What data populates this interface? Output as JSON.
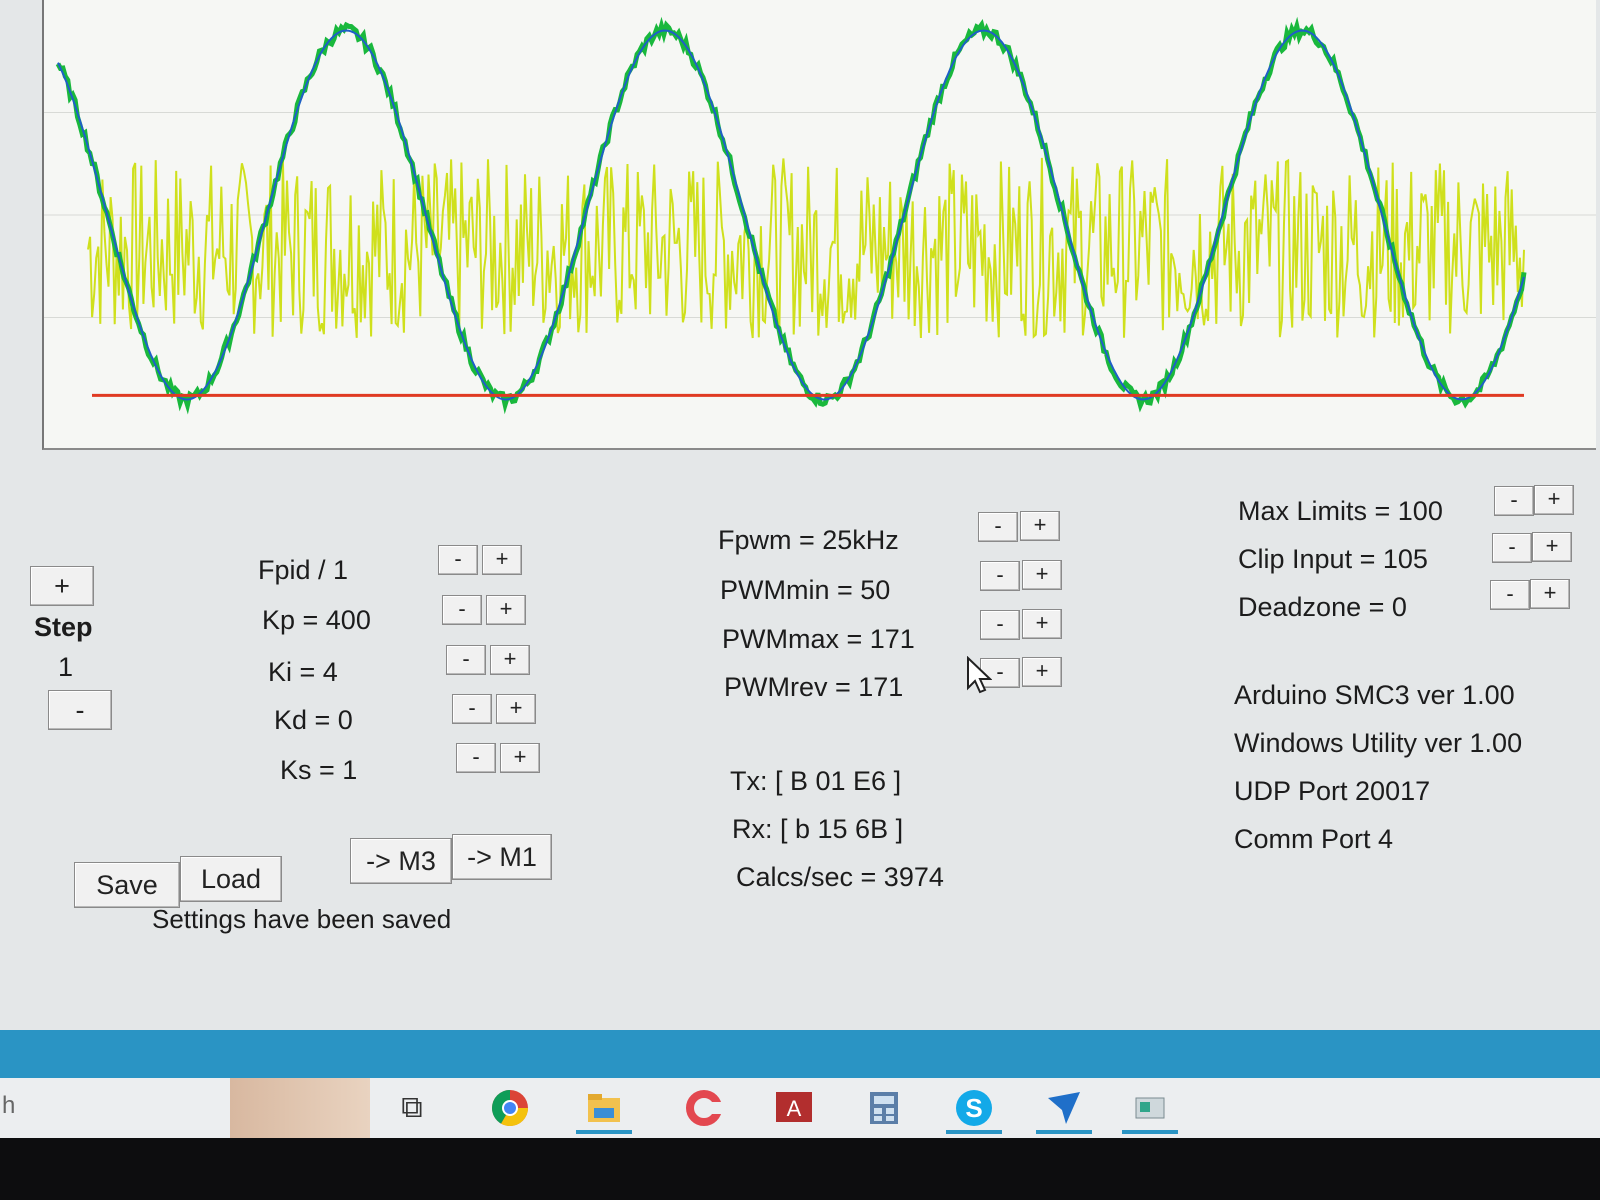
{
  "left_controls": {
    "step_plus": "+",
    "step_label": "Step",
    "step_value": "1",
    "step_minus": "-"
  },
  "pid": {
    "rows": [
      {
        "label": "Fpid / 1",
        "minus": "-",
        "plus": "+"
      },
      {
        "label": "Kp = 400",
        "minus": "-",
        "plus": "+"
      },
      {
        "label": "Ki = 4",
        "minus": "-",
        "plus": "+"
      },
      {
        "label": "Kd = 0",
        "minus": "-",
        "plus": "+"
      },
      {
        "label": "Ks = 1",
        "minus": "-",
        "plus": "+"
      }
    ]
  },
  "pwm": {
    "rows": [
      {
        "label": "Fpwm = 25kHz",
        "minus": "-",
        "plus": "+"
      },
      {
        "label": "PWMmin = 50",
        "minus": "-",
        "plus": "+"
      },
      {
        "label": "PWMmax = 171",
        "minus": "-",
        "plus": "+"
      },
      {
        "label": "PWMrev = 171",
        "minus": "-",
        "plus": "+"
      }
    ]
  },
  "limits": {
    "rows": [
      {
        "label": "Max Limits = 100",
        "minus": "-",
        "plus": "+"
      },
      {
        "label": "Clip Input = 105",
        "minus": "-",
        "plus": "+"
      },
      {
        "label": "Deadzone = 0",
        "minus": "-",
        "plus": "+"
      }
    ]
  },
  "comms": {
    "tx": "Tx: [ B 01 E6 ]",
    "rx": "Rx: [ b 15 6B ]",
    "calcs": "Calcs/sec = 3974"
  },
  "info": {
    "arduino": "Arduino SMC3 ver 1.00",
    "windows": "Windows Utility ver 1.00",
    "udp": "UDP Port 20017",
    "comm": "Comm Port 4"
  },
  "buttons": {
    "save": "Save",
    "load": "Load",
    "m3": "-> M3",
    "m1": "-> M1"
  },
  "status": "Settings have been saved",
  "taskbar": {
    "search_fragment": "h",
    "icons": [
      "task-view-icon",
      "chrome-icon",
      "file-explorer-icon",
      "creative-cloud-icon",
      "adobe-acrobat-icon",
      "calculator-icon",
      "skype-icon",
      "send-arrow-icon",
      "app-window-icon"
    ]
  },
  "colors": {
    "feedback_trace": "#19b83c",
    "target_trace": "#1f5ec8",
    "pwm_trace": "#cfe01c",
    "limit_line": "#e03a22",
    "taskbar_accent": "#2a94c4"
  },
  "chart_data": {
    "type": "line",
    "title": "",
    "series": [
      {
        "type": "sine",
        "cycles": 4.6,
        "amplitude": 0.45,
        "mean": 0.5,
        "phase": 0.6
      },
      {
        "type": "noise",
        "mean": 0.42,
        "spread": 0.22
      },
      {
        "type": "constant",
        "value": 0.06
      }
    ],
    "ylim": [
      0,
      1
    ],
    "grid": true
  }
}
